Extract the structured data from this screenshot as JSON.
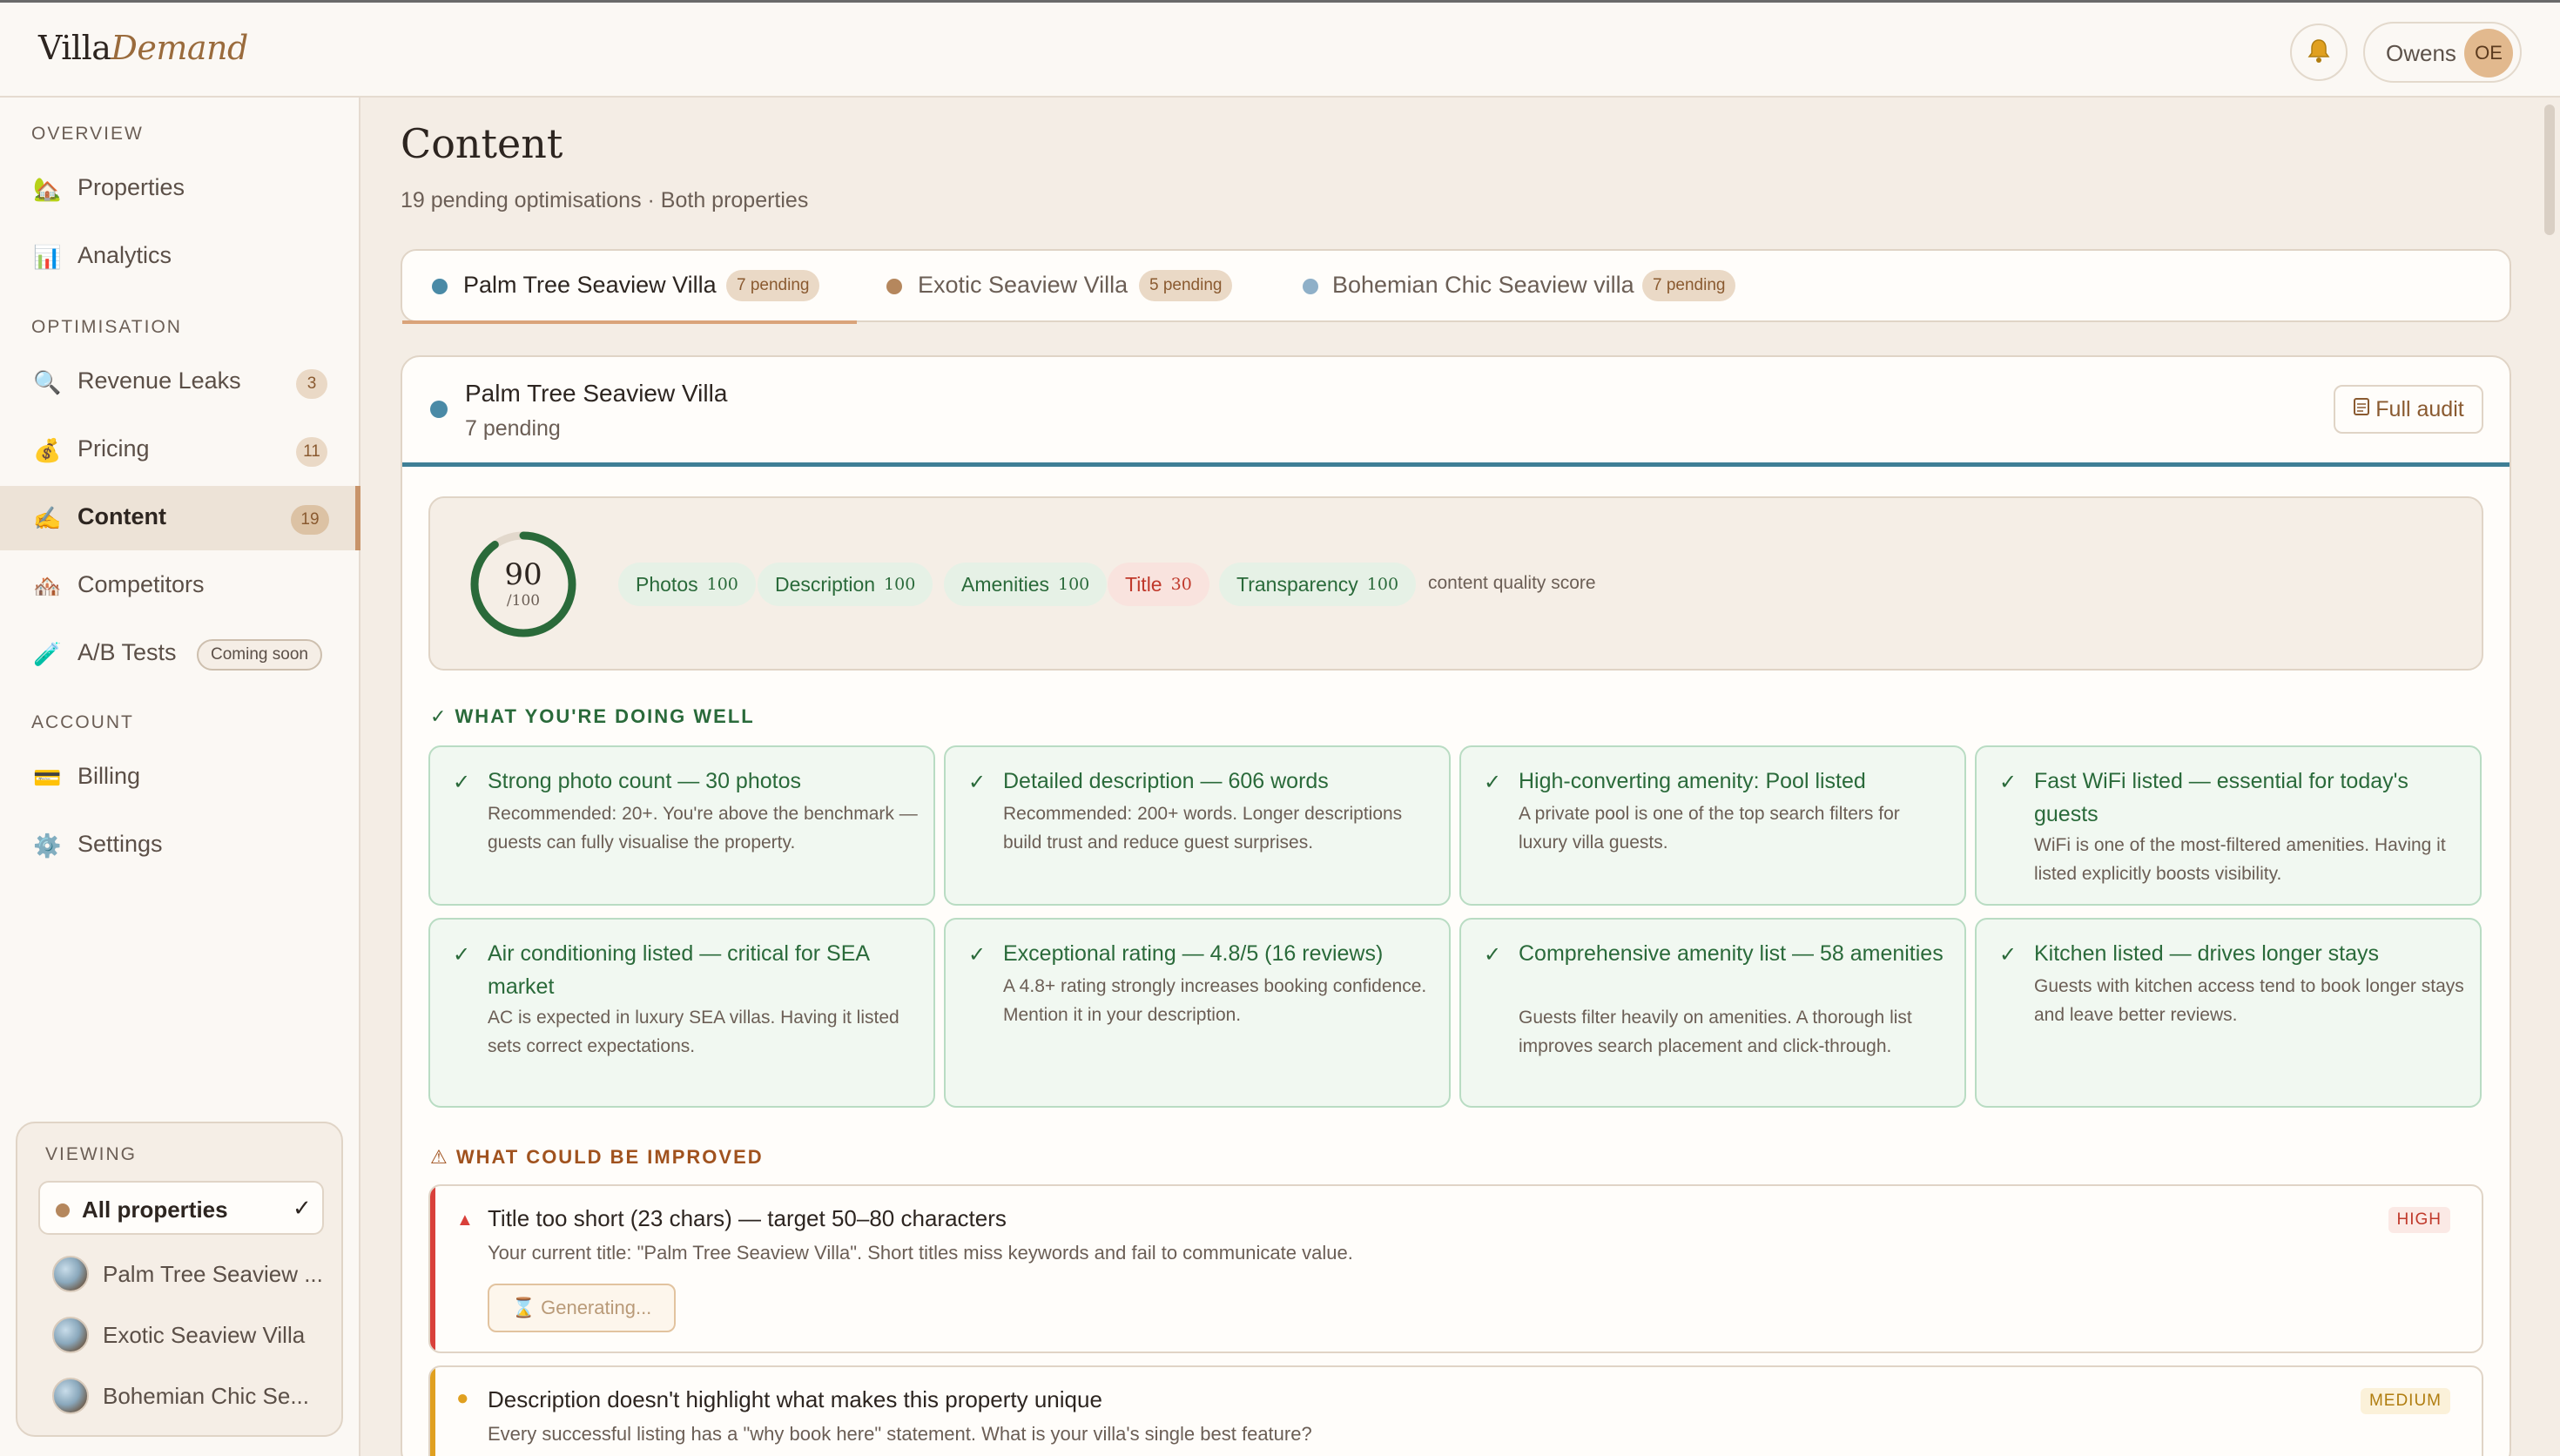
{
  "app": {
    "logo_part1": "Villa",
    "logo_part2": "Demand",
    "user_name": "Owens",
    "user_initials": "OE"
  },
  "sidebar": {
    "sections": {
      "overview": "OVERVIEW",
      "optimisation": "OPTIMISATION",
      "account": "ACCOUNT"
    },
    "items": [
      {
        "label": "Properties",
        "icon": "house-icon"
      },
      {
        "label": "Analytics",
        "icon": "bar-chart-icon"
      },
      {
        "label": "Revenue Leaks",
        "icon": "magnifier-icon",
        "badge": "3"
      },
      {
        "label": "Pricing",
        "icon": "money-bag-icon",
        "badge": "11"
      },
      {
        "label": "Content",
        "icon": "pen-icon",
        "badge": "19",
        "active": true
      },
      {
        "label": "Competitors",
        "icon": "houses-icon"
      },
      {
        "label": "A/B Tests",
        "icon": "test-tube-icon",
        "tag": "Coming soon"
      },
      {
        "label": "Billing",
        "icon": "credit-card-icon"
      },
      {
        "label": "Settings",
        "icon": "gear-icon"
      }
    ],
    "viewing": {
      "label": "VIEWING",
      "selected": "All properties",
      "properties": [
        "Palm Tree Seaview ...",
        "Exotic Seaview Villa",
        "Bohemian Chic Se..."
      ]
    }
  },
  "main": {
    "title": "Content",
    "subtitle": "19 pending optimisations · Both properties",
    "tabs": [
      {
        "label": "Palm Tree Seaview Villa",
        "pending": "7 pending",
        "color": "#4a8aa6",
        "active": true
      },
      {
        "label": "Exotic Seaview Villa",
        "pending": "5 pending",
        "color": "#b5875d"
      },
      {
        "label": "Bohemian Chic Seaview villa",
        "pending": "7 pending",
        "color": "#8fb0c8"
      }
    ],
    "card": {
      "title": "Palm Tree Seaview Villa",
      "subtitle": "7 pending",
      "audit_label": "Full audit",
      "score": {
        "value": "90",
        "max": "/100",
        "note": "content quality score",
        "chips": [
          {
            "label": "Photos",
            "score": "100",
            "status": "good"
          },
          {
            "label": "Description",
            "score": "100",
            "status": "good"
          },
          {
            "label": "Amenities",
            "score": "100",
            "status": "good"
          },
          {
            "label": "Title",
            "score": "30",
            "status": "bad"
          },
          {
            "label": "Transparency",
            "score": "100",
            "status": "good"
          }
        ]
      },
      "doing_well_label": "WHAT YOU'RE DOING WELL",
      "doing_well": [
        {
          "title": "Strong photo count — 30 photos",
          "desc": "Recommended: 20+. You're above the benchmark — guests can fully visualise the property."
        },
        {
          "title": "Detailed description — 606 words",
          "desc": "Recommended: 200+ words. Longer descriptions build trust and reduce guest surprises."
        },
        {
          "title": "High-converting amenity: Pool listed",
          "desc": "A private pool is one of the top search filters for luxury villa guests."
        },
        {
          "title": "Fast WiFi listed — essential for today's guests",
          "desc": "WiFi is one of the most-filtered amenities. Having it listed explicitly boosts visibility."
        },
        {
          "title": "Air conditioning listed — critical for SEA market",
          "desc": "AC is expected in luxury SEA villas. Having it listed sets correct expectations."
        },
        {
          "title": "Exceptional rating — 4.8/5 (16 reviews)",
          "desc": "A 4.8+ rating strongly increases booking confidence. Mention it in your description."
        },
        {
          "title": "Comprehensive amenity list — 58 amenities",
          "desc": "Guests filter heavily on amenities. A thorough list improves search placement and click-through."
        },
        {
          "title": "Kitchen listed — drives longer stays",
          "desc": "Guests with kitchen access tend to book longer stays and leave better reviews."
        }
      ],
      "improve_label": "WHAT COULD BE IMPROVED",
      "improvements": [
        {
          "title": "Title too short (23 chars) — target 50–80 characters",
          "desc": "Your current title: \"Palm Tree Seaview Villa\". Short titles miss keywords and fail to communicate value.",
          "severity": "HIGH",
          "button": "Generating..."
        },
        {
          "title": "Description doesn't highlight what makes this property unique",
          "desc": "Every successful listing has a \"why book here\" statement. What is your villa's single best feature?",
          "severity": "MEDIUM"
        }
      ]
    }
  },
  "colors": {
    "accent": "#c8946a",
    "success": "#2a6a3a",
    "danger": "#d9403a",
    "warning": "#e0a020",
    "property_blue": "#4a8aa6"
  }
}
